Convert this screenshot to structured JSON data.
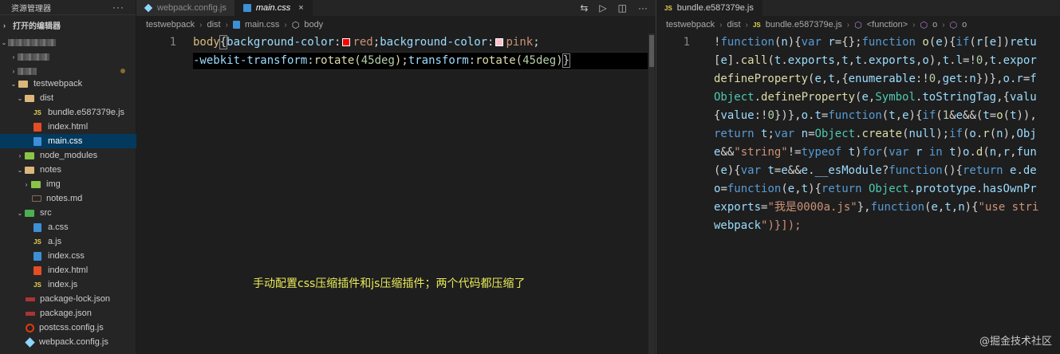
{
  "sidebar": {
    "title": "资源管理器",
    "more": "···",
    "open_editors": "打开的编辑器",
    "tree": [
      {
        "label": "testwebpack",
        "indent": 1,
        "icon": "folder-open-icon",
        "twisty": "⌄"
      },
      {
        "label": "dist",
        "indent": 2,
        "icon": "folder-open-icon",
        "twisty": "⌄"
      },
      {
        "label": "bundle.e587379e.js",
        "indent": 3,
        "icon": "js-file-icon",
        "twisty": ""
      },
      {
        "label": "index.html",
        "indent": 3,
        "icon": "html-file-icon",
        "twisty": ""
      },
      {
        "label": "main.css",
        "indent": 3,
        "icon": "css-file-icon",
        "twisty": "",
        "selected": true
      },
      {
        "label": "node_modules",
        "indent": 2,
        "icon": "folder-green-icon",
        "twisty": "›"
      },
      {
        "label": "notes",
        "indent": 2,
        "icon": "folder-open-icon",
        "twisty": "⌄"
      },
      {
        "label": "img",
        "indent": 3,
        "icon": "folder-green-icon",
        "twisty": "›"
      },
      {
        "label": "notes.md",
        "indent": 3,
        "icon": "markdown-file-icon",
        "twisty": ""
      },
      {
        "label": "src",
        "indent": 2,
        "icon": "folder-src-icon",
        "twisty": "⌄"
      },
      {
        "label": "a.css",
        "indent": 3,
        "icon": "css-file-icon",
        "twisty": ""
      },
      {
        "label": "a.js",
        "indent": 3,
        "icon": "js-file-icon",
        "twisty": ""
      },
      {
        "label": "index.css",
        "indent": 3,
        "icon": "css-file-icon",
        "twisty": ""
      },
      {
        "label": "index.html",
        "indent": 3,
        "icon": "html-file-icon",
        "twisty": ""
      },
      {
        "label": "index.js",
        "indent": 3,
        "icon": "js-file-icon",
        "twisty": ""
      },
      {
        "label": "package-lock.json",
        "indent": 2,
        "icon": "npm-file-icon",
        "twisty": ""
      },
      {
        "label": "package.json",
        "indent": 2,
        "icon": "npm-file-icon",
        "twisty": ""
      },
      {
        "label": "postcss.config.js",
        "indent": 2,
        "icon": "postcss-file-icon",
        "twisty": ""
      },
      {
        "label": "webpack.config.js",
        "indent": 2,
        "icon": "webpack-file-icon",
        "twisty": ""
      }
    ]
  },
  "editor1": {
    "tabs": [
      {
        "label": "webpack.config.js",
        "active": false
      },
      {
        "label": "main.css",
        "active": true,
        "close": "×"
      }
    ],
    "breadcrumb": [
      "testwebpack",
      "dist",
      "main.css",
      "body"
    ],
    "line_number": "1",
    "code_line1": {
      "selector": "body",
      "open": "{",
      "prop1": "background-color",
      "colon": ":",
      "val1": "red",
      "semi": ";",
      "prop2": "background-color",
      "val2": "pink"
    },
    "code_line2": {
      "prop3": "-webkit-transform",
      "val3_fn": "rotate(",
      "val3_num": "45deg",
      "val3_close": ")",
      "prop4": "transform",
      "val4_fn": "rotate(",
      "val4_num": "45deg",
      "val4_close": ")",
      "close": "}"
    },
    "swatch_colors": {
      "red": "#ff0000",
      "pink": "#ffc0cb"
    },
    "annotation": "手动配置css压缩插件和js压缩插件；两个代码都压缩了"
  },
  "editor2": {
    "tabs": [
      {
        "label": "bundle.e587379e.js",
        "active": true
      }
    ],
    "breadcrumb": [
      "testwebpack",
      "dist",
      "bundle.e587379e.js",
      "<function>",
      "o",
      "o"
    ],
    "line_number": "1",
    "code_lines": [
      "!function(n){var r={};function o(e){if(r[e])retu",
      "[e].call(t.exports,t,t.exports,o),t.l=!0,t.expor",
      "defineProperty(e,t,{enumerable:!0,get:n})},o.r=f",
      "Object.defineProperty(e,Symbol.toStringTag,{valu",
      "{value:!0})},o.t=function(t,e){if(1&e&&(t=o(t)),",
      "return t;var n=Object.create(null);if(o.r(n),Obj",
      "e&&\"string\"!=typeof t)for(var r in t)o.d(n,r,fun",
      "(e){var t=e&&e.__esModule?function(){return e.de",
      "o=function(e,t){return Object.prototype.hasOwnPr",
      "exports=\"我是0000a.js\"},function(e,t,n){\"use stri",
      "webpack\")}]);"
    ],
    "watermark": "@掘金技术社区"
  }
}
